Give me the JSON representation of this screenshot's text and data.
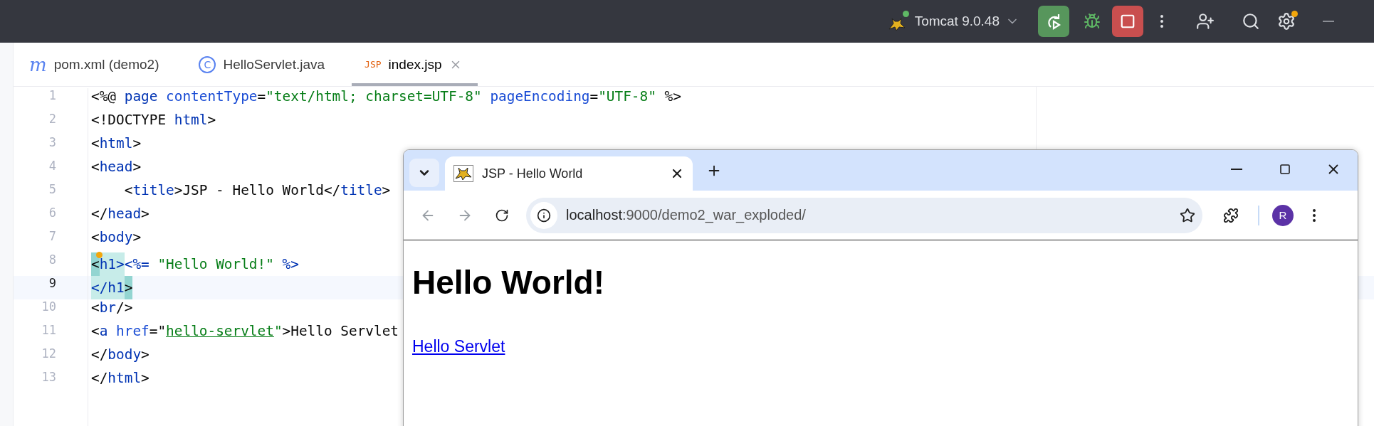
{
  "title_bar": {
    "run_config": {
      "label": "Tomcat 9.0.48",
      "running": true
    },
    "settings_badge": true
  },
  "editor_tabs": [
    {
      "label": "pom.xml (demo2)",
      "kind": "maven",
      "icon": "m",
      "selected": false
    },
    {
      "label": "HelloServlet.java",
      "kind": "java",
      "icon": "C",
      "selected": false
    },
    {
      "label": "index.jsp",
      "kind": "jsp",
      "icon": "JSP",
      "selected": true
    }
  ],
  "code": {
    "lines": [
      {
        "number": "1",
        "current": false,
        "tokens": [
          {
            "text": "<%@ ",
            "kind": "punct"
          },
          {
            "text": "page ",
            "kind": "tag"
          },
          {
            "text": "contentType",
            "kind": "attr"
          },
          {
            "text": "=",
            "kind": "punct"
          },
          {
            "text": "\"text/html; charset=UTF-8\"",
            "kind": "string"
          },
          {
            "text": " pageEncoding",
            "kind": "attr"
          },
          {
            "text": "=",
            "kind": "punct"
          },
          {
            "text": "\"UTF-8\"",
            "kind": "string"
          },
          {
            "text": " %>",
            "kind": "punct"
          }
        ]
      },
      {
        "number": "2",
        "current": false,
        "tokens": [
          {
            "text": "<!DOCTYPE ",
            "kind": "punct"
          },
          {
            "text": "html",
            "kind": "tag"
          },
          {
            "text": ">",
            "kind": "punct"
          }
        ]
      },
      {
        "number": "3",
        "current": false,
        "tokens": [
          {
            "text": "<",
            "kind": "punct"
          },
          {
            "text": "html",
            "kind": "tag"
          },
          {
            "text": ">",
            "kind": "punct"
          }
        ]
      },
      {
        "number": "4",
        "current": false,
        "tokens": [
          {
            "text": "<",
            "kind": "punct"
          },
          {
            "text": "head",
            "kind": "tag"
          },
          {
            "text": ">",
            "kind": "punct"
          }
        ]
      },
      {
        "number": "5",
        "current": false,
        "tokens": [
          {
            "text": "    <",
            "kind": "punct"
          },
          {
            "text": "title",
            "kind": "tag"
          },
          {
            "text": ">JSP - Hello World</",
            "kind": "punct"
          },
          {
            "text": "title",
            "kind": "tag"
          },
          {
            "text": ">",
            "kind": "punct"
          }
        ]
      },
      {
        "number": "6",
        "current": false,
        "tokens": [
          {
            "text": "</",
            "kind": "punct"
          },
          {
            "text": "head",
            "kind": "tag"
          },
          {
            "text": ">",
            "kind": "punct"
          }
        ]
      },
      {
        "number": "7",
        "current": false,
        "tokens": [
          {
            "text": "<",
            "kind": "punct"
          },
          {
            "text": "body",
            "kind": "tag"
          },
          {
            "text": ">",
            "kind": "punct"
          }
        ]
      },
      {
        "number": "8",
        "current": false,
        "tokens": [
          {
            "text": "<",
            "kind": "match-edge"
          },
          {
            "text": "h1>",
            "kind": "match"
          },
          {
            "text": "<%= ",
            "kind": "tag"
          },
          {
            "text": "\"Hello World!\"",
            "kind": "string"
          },
          {
            "text": " %>",
            "kind": "tag"
          }
        ]
      },
      {
        "number": "9",
        "current": true,
        "tokens": [
          {
            "text": "</h1",
            "kind": "match"
          },
          {
            "text": ">",
            "kind": "match-edge"
          }
        ]
      },
      {
        "number": "10",
        "current": false,
        "tokens": [
          {
            "text": "<",
            "kind": "punct"
          },
          {
            "text": "br",
            "kind": "tag"
          },
          {
            "text": "/>",
            "kind": "punct"
          }
        ]
      },
      {
        "number": "11",
        "current": false,
        "tokens": [
          {
            "text": "<",
            "kind": "punct"
          },
          {
            "text": "a ",
            "kind": "tag"
          },
          {
            "text": "href",
            "kind": "attr"
          },
          {
            "text": "=\"",
            "kind": "punct"
          },
          {
            "text": "hello-servlet",
            "kind": "link-string"
          },
          {
            "text": "\"",
            "kind": "string"
          },
          {
            "text": ">Hello Servlet",
            "kind": "punct"
          }
        ]
      },
      {
        "number": "12",
        "current": false,
        "tokens": [
          {
            "text": "</",
            "kind": "punct"
          },
          {
            "text": "body",
            "kind": "tag"
          },
          {
            "text": ">",
            "kind": "punct"
          }
        ]
      },
      {
        "number": "13",
        "current": false,
        "tokens": [
          {
            "text": "</",
            "kind": "punct"
          },
          {
            "text": "html",
            "kind": "tag"
          },
          {
            "text": ">",
            "kind": "punct"
          }
        ]
      }
    ]
  },
  "browser": {
    "tabs": [
      {
        "title": "JSP - Hello World",
        "selected": true
      }
    ],
    "address": {
      "host": "localhost",
      "rest": ":9000/demo2_war_exploded/"
    },
    "profile": "R",
    "page": {
      "heading": "Hello World!",
      "link": "Hello Servlet"
    }
  }
}
